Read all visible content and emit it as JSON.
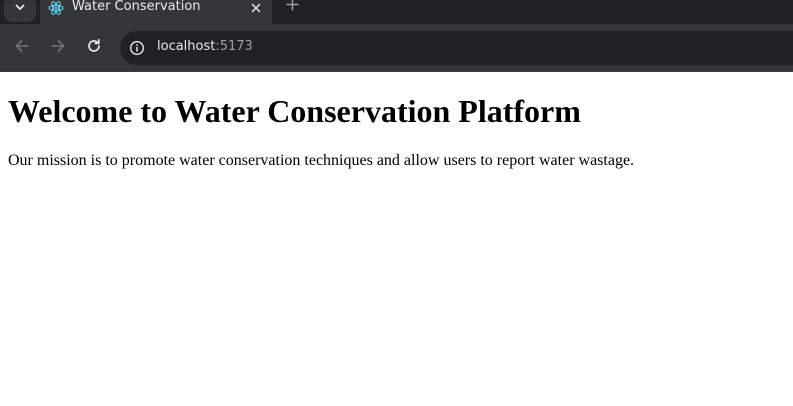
{
  "browser": {
    "tab": {
      "title": "Water Conservation",
      "favicon": "react-logo-icon"
    },
    "address_bar": {
      "host": "localhost",
      "port": ":5173"
    },
    "icons": {
      "tab_list": "chevron-down-icon",
      "close": "close-icon",
      "new_tab": "plus-icon",
      "back": "arrow-left-icon",
      "forward": "arrow-right-icon",
      "reload": "reload-icon",
      "site_info": "info-icon"
    }
  },
  "page": {
    "heading": "Welcome to Water Conservation Platform",
    "mission": "Our mission is to promote water conservation techniques and allow users to report water wastage."
  },
  "colors": {
    "chrome_dark": "#202124",
    "chrome_toolbar": "#35363a",
    "react_blue": "#61dafb"
  }
}
